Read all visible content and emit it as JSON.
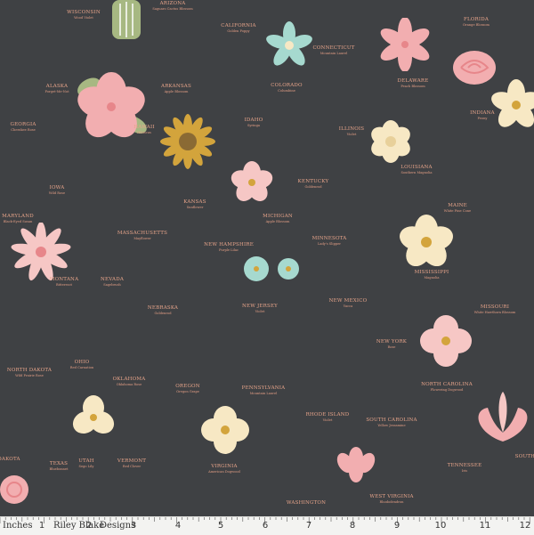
{
  "labels": [
    {
      "id": "arizona",
      "state": "Arizona",
      "flower": "Saguaro Cactus Blossom"
    },
    {
      "id": "wisconsin",
      "state": "Wisconsin",
      "flower": "Wood Violet"
    },
    {
      "id": "california",
      "state": "California",
      "flower": "Golden Poppy"
    },
    {
      "id": "connecticut",
      "state": "Connecticut",
      "flower": "Mountain Laurel"
    },
    {
      "id": "florida",
      "state": "Florida",
      "flower": "Orange Blossom"
    },
    {
      "id": "alaska",
      "state": "Alaska",
      "flower": "Forget-Me-Not"
    },
    {
      "id": "arkansas",
      "state": "Arkansas",
      "flower": "Apple Blossom"
    },
    {
      "id": "colorado",
      "state": "Colorado",
      "flower": "Columbine"
    },
    {
      "id": "delaware",
      "state": "Delaware",
      "flower": "Peach Blossom"
    },
    {
      "id": "georgia",
      "state": "Georgia",
      "flower": "Cherokee Rose"
    },
    {
      "id": "hawaii",
      "state": "Hawaii",
      "flower": "Hibiscus"
    },
    {
      "id": "idaho",
      "state": "Idaho",
      "flower": "Syringa"
    },
    {
      "id": "illinois",
      "state": "Illinois",
      "flower": "Violet"
    },
    {
      "id": "indiana",
      "state": "Indiana",
      "flower": "Peony"
    },
    {
      "id": "iowa",
      "state": "Iowa",
      "flower": "Wild Rose"
    },
    {
      "id": "kentucky",
      "state": "Kentucky",
      "flower": "Goldenrod"
    },
    {
      "id": "louisiana",
      "state": "Louisiana",
      "flower": "Southern Magnolia"
    },
    {
      "id": "kansas",
      "state": "Kansas",
      "flower": "Sunflower"
    },
    {
      "id": "maine",
      "state": "Maine",
      "flower": "White Pine Cone"
    },
    {
      "id": "maryland",
      "state": "Maryland",
      "flower": "Black-Eyed Susan"
    },
    {
      "id": "massachusetts",
      "state": "Massachusetts",
      "flower": "Mayflower"
    },
    {
      "id": "michigan",
      "state": "Michigan",
      "flower": "Apple Blossom"
    },
    {
      "id": "minnesota",
      "state": "Minnesota",
      "flower": "Lady's Slipper"
    },
    {
      "id": "newhampshire",
      "state": "New Hampshire",
      "flower": "Purple Lilac"
    },
    {
      "id": "mississippi",
      "state": "Mississippi",
      "flower": "Magnolia"
    },
    {
      "id": "montana",
      "state": "Montana",
      "flower": "Bitterroot"
    },
    {
      "id": "nevada",
      "state": "Nevada",
      "flower": "Sagebrush"
    },
    {
      "id": "newjersey",
      "state": "New Jersey",
      "flower": "Violet"
    },
    {
      "id": "newmexico",
      "state": "New Mexico",
      "flower": "Yucca"
    },
    {
      "id": "missouri",
      "state": "Missouri",
      "flower": "White Hawthorn Blossom"
    },
    {
      "id": "nebraska",
      "state": "Nebraska",
      "flower": "Goldenrod"
    },
    {
      "id": "northdakota",
      "state": "North Dakota",
      "flower": "Wild Prairie Rose"
    },
    {
      "id": "ohio",
      "state": "Ohio",
      "flower": "Red Carnation"
    },
    {
      "id": "newyork",
      "state": "New York",
      "flower": "Rose"
    },
    {
      "id": "oklahoma",
      "state": "Oklahoma",
      "flower": "Oklahoma Rose"
    },
    {
      "id": "oregon",
      "state": "Oregon",
      "flower": "Oregon Grape"
    },
    {
      "id": "pennsylvania",
      "state": "Pennsylvania",
      "flower": "Mountain Laurel"
    },
    {
      "id": "northcarolina",
      "state": "North Carolina",
      "flower": "Flowering Dogwood"
    },
    {
      "id": "rhodeisland",
      "state": "Rhode Island",
      "flower": "Violet"
    },
    {
      "id": "southcarolina",
      "state": "South Carolina",
      "flower": "Yellow Jessamine"
    },
    {
      "id": "dakota",
      "state": "Dakota",
      "flower": ""
    },
    {
      "id": "texas",
      "state": "Texas",
      "flower": "Bluebonnet"
    },
    {
      "id": "utah",
      "state": "Utah",
      "flower": "Sego Lily"
    },
    {
      "id": "vermont",
      "state": "Vermont",
      "flower": "Red Clover"
    },
    {
      "id": "virginia",
      "state": "Virginia",
      "flower": "American Dogwood"
    },
    {
      "id": "tennessee",
      "state": "Tennessee",
      "flower": "Iris"
    },
    {
      "id": "south",
      "state": "South",
      "flower": ""
    },
    {
      "id": "washington",
      "state": "Washington",
      "flower": ""
    },
    {
      "id": "westvirginia",
      "state": "West Virginia",
      "flower": "Rhododendron"
    }
  ],
  "selvage": {
    "units_label": "Inches",
    "brand": "Riley Blake",
    "designs": "Designs",
    "numbers": [
      "1",
      "2",
      "3",
      "4",
      "5",
      "6",
      "7",
      "8",
      "9",
      "10",
      "11",
      "12"
    ]
  },
  "colors": {
    "background": "#3f4144",
    "pink": "#f2aeb0",
    "cream": "#f7e8c4",
    "mint": "#a6d9cf",
    "mustard": "#d3a43c",
    "leaf": "#a7b882",
    "coral": "#e7a48a"
  }
}
